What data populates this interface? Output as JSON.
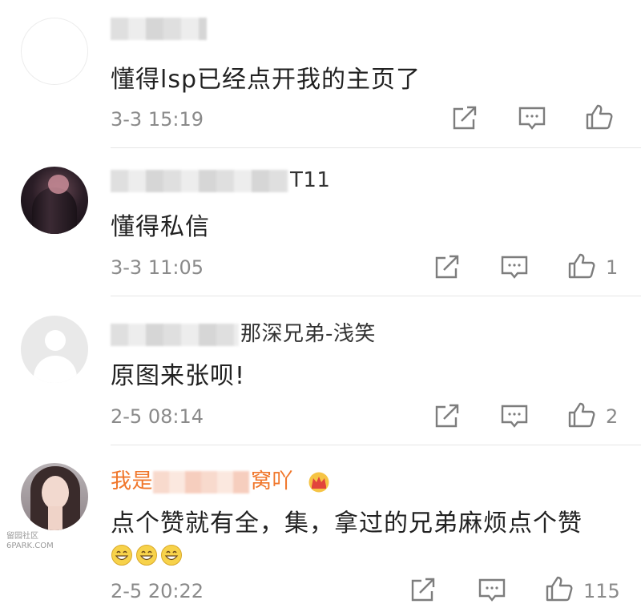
{
  "comments": [
    {
      "username_visible": "",
      "text": "懂得lsp已经点开我的主页了",
      "time": "3-3 15:19",
      "like_count": ""
    },
    {
      "username_visible": "T11",
      "text": "懂得私信",
      "time": "3-3 11:05",
      "like_count": "1"
    },
    {
      "username_visible": "那深兄弟-浅笑",
      "text": "原图来张呗!",
      "time": "2-5 08:14",
      "like_count": "2"
    },
    {
      "username_prefix": "我是",
      "username_suffix": "窝吖",
      "text": "点个赞就有全，集，拿过的兄弟麻烦点个赞",
      "time": "2-5 20:22",
      "like_count": "115"
    }
  ],
  "watermark": {
    "line1": "留园社区",
    "line2": "6PARK.COM"
  },
  "icons": {
    "share": "share-icon",
    "reply": "comment-icon",
    "like": "thumbs-up-icon",
    "vip": "crown-icon",
    "emoji": "grin-emoji-icon"
  },
  "colors": {
    "vip_name": "#f0762a",
    "icon": "#7d7d7d",
    "meta": "#8a8a8a"
  }
}
